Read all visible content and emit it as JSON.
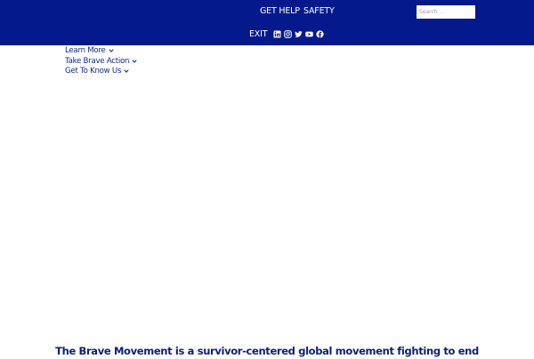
{
  "header": {
    "get_help": "GET HELP",
    "safety": "SAFETY",
    "exit": "EXIT",
    "search": {
      "placeholder": "Search ...",
      "value": ""
    },
    "socials": [
      "linkedin-icon",
      "instagram-icon",
      "twitter-icon",
      "youtube-icon",
      "facebook-icon"
    ],
    "background_color": "#03198c"
  },
  "menu": {
    "items": [
      {
        "label": "Learn More"
      },
      {
        "label": "Take Brave Action"
      },
      {
        "label": "Get To Know Us"
      }
    ],
    "color": "#0f2a8a"
  },
  "hero": {
    "text": "The Brave Movement is a survivor-centered global movement fighting to end"
  }
}
